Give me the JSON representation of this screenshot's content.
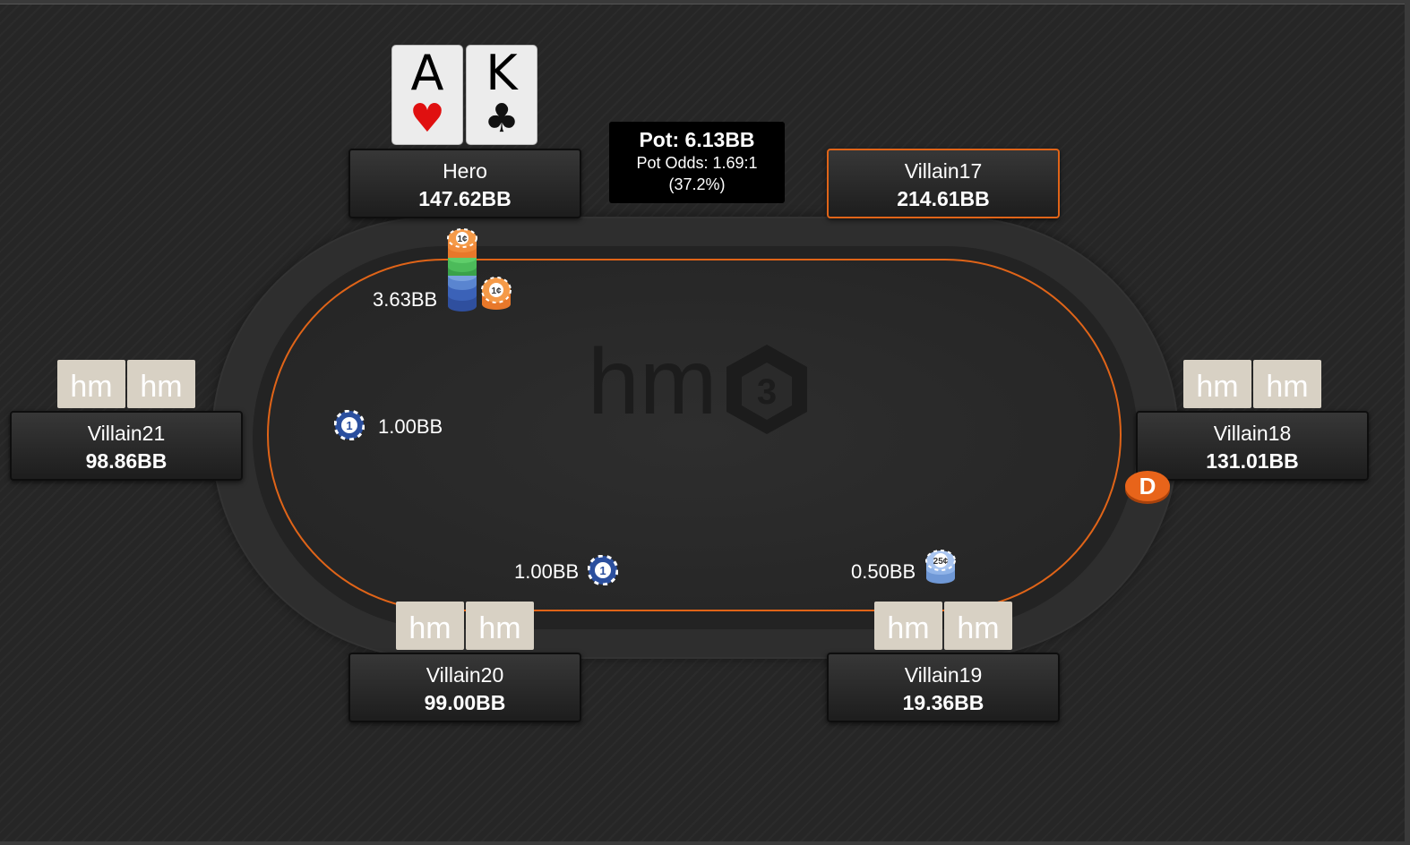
{
  "table": {
    "logo_text": "hm",
    "logo_badge": "3",
    "pot": {
      "label": "Pot: 6.13BB",
      "odds": "Pot Odds: 1.69:1",
      "percent": "(37.2%)"
    },
    "dealer_label": "D"
  },
  "hero": {
    "name": "Hero",
    "stack": "147.62BB",
    "cards": [
      {
        "rank": "A",
        "suit": "♥",
        "color": "#e01010"
      },
      {
        "rank": "K",
        "suit": "♣",
        "color": "#111111"
      }
    ],
    "bet": "3.63BB"
  },
  "players": {
    "villain17": {
      "name": "Villain17",
      "stack": "214.61BB"
    },
    "villain18": {
      "name": "Villain18",
      "stack": "131.01BB"
    },
    "villain19": {
      "name": "Villain19",
      "stack": "19.36BB",
      "bet": "0.50BB"
    },
    "villain20": {
      "name": "Villain20",
      "stack": "99.00BB",
      "bet": "1.00BB"
    },
    "villain21": {
      "name": "Villain21",
      "stack": "98.86BB",
      "bet": "1.00BB"
    }
  },
  "hidden_card_label": "hm",
  "chips": {
    "one_cent": "1¢",
    "one": "1",
    "twenty_five_cent": "25¢"
  },
  "colors": {
    "accent": "#e06418",
    "felt": "#2a2a2a",
    "card_back": "#d8d1c4",
    "pot_box": "#000000"
  }
}
